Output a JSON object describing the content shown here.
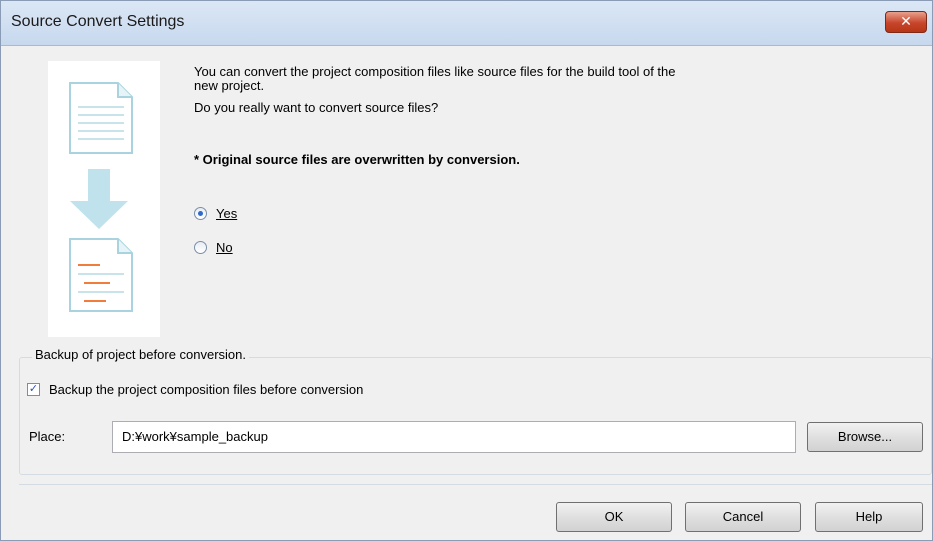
{
  "window": {
    "title": "Source Convert Settings",
    "close_glyph": "✕"
  },
  "message": {
    "line1": "You can convert the project composition files like source files for the build tool of the",
    "line2": "new project.",
    "line3": "Do you really want to convert source files?",
    "warning": "* Original source files are overwritten by conversion."
  },
  "radios": [
    {
      "label": "Yes",
      "checked": true
    },
    {
      "label": "No",
      "checked": false
    }
  ],
  "backup": {
    "group_label": "Backup of project before conversion.",
    "checkbox_label": "Backup the project composition files before conversion",
    "checked": true,
    "place_label": "Place:",
    "place_value": "D:¥work¥sample_backup",
    "browse_label": "Browse..."
  },
  "buttons": {
    "ok": "OK",
    "cancel": "Cancel",
    "help": "Help"
  },
  "icons": {
    "document": "document-icon",
    "arrow": "arrow-down-icon",
    "converted": "converted-document-icon"
  },
  "colors": {
    "accent_orange": "#f07d3c",
    "arrow_blue": "#bfe2ec",
    "title_bar": "#c7d8ee"
  }
}
